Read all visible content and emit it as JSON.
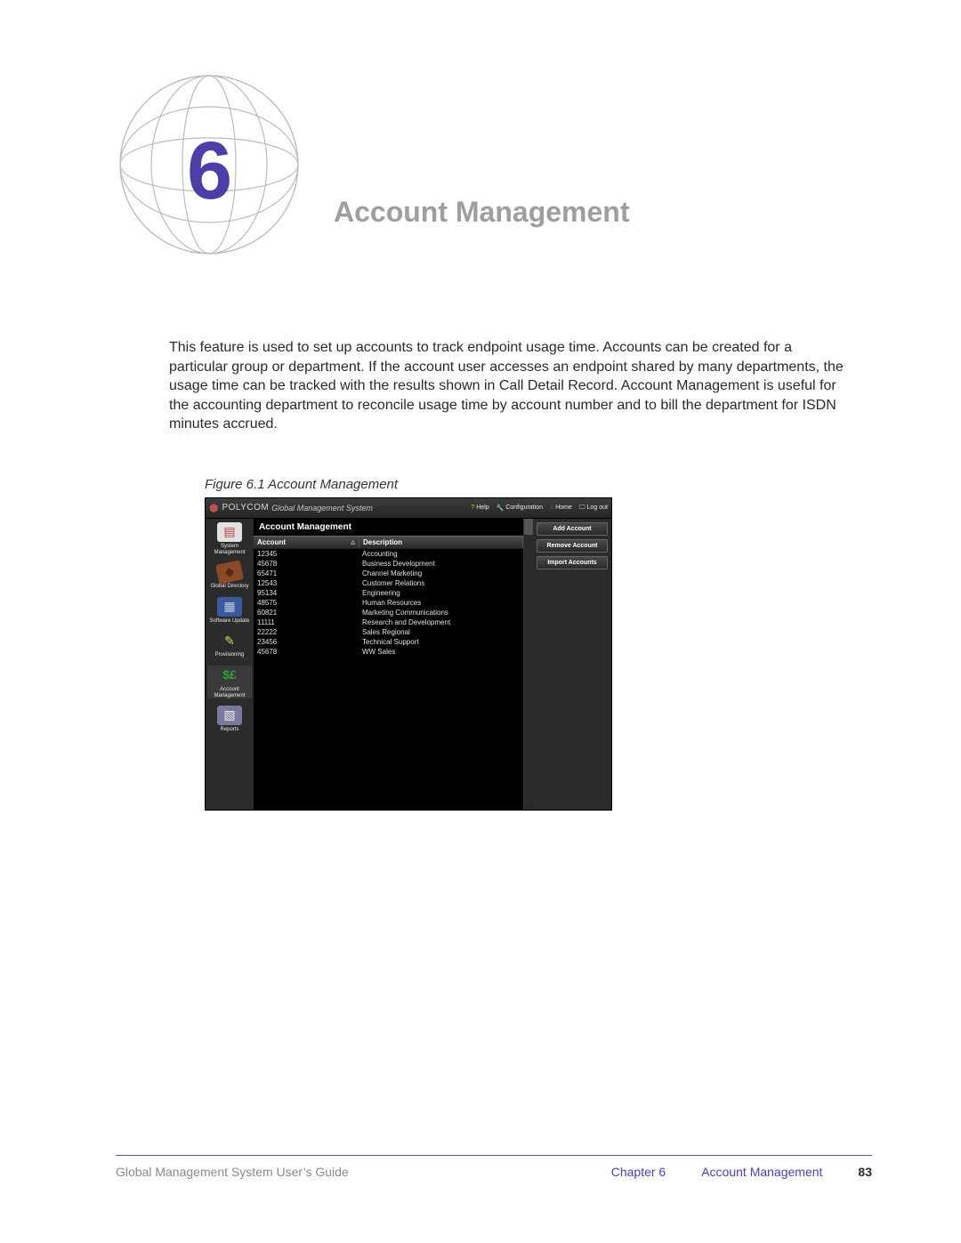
{
  "chapter": {
    "number": "6",
    "title": "Account Management"
  },
  "body_paragraph": "This feature is used to set up accounts to track endpoint usage time. Accounts can be created for a particular group or department. If the account user accesses an endpoint shared by many departments, the usage time can be tracked with the results shown in Call Detail Record. Account Management is useful for the accounting department to reconcile usage time by account number and to bill the department for ISDN minutes accrued.",
  "figure_caption": "Figure 6.1 Account Management",
  "app": {
    "brand": "POLYCOM",
    "system_name": "Global Management System",
    "toolbar": {
      "help": "Help",
      "configuration": "Configuration",
      "home": "Home",
      "logout": "Log out"
    },
    "sidebar": [
      {
        "label": "System Management",
        "icon": "sys"
      },
      {
        "label": "Global Directory",
        "icon": "dir"
      },
      {
        "label": "Software Update",
        "icon": "upd"
      },
      {
        "label": "Provisioning",
        "icon": "prov"
      },
      {
        "label": "Account Management",
        "icon": "acct"
      },
      {
        "label": "Reports",
        "icon": "rep"
      }
    ],
    "panel_title": "Account Management",
    "columns": {
      "account": "Account",
      "description": "Description"
    },
    "rows": [
      {
        "account": "12345",
        "description": "Accounting"
      },
      {
        "account": "45678",
        "description": "Business Development"
      },
      {
        "account": "65471",
        "description": "Channel Marketing"
      },
      {
        "account": "12543",
        "description": "Customer Relations"
      },
      {
        "account": "95134",
        "description": "Engineering"
      },
      {
        "account": "48575",
        "description": "Human Resources"
      },
      {
        "account": "60821",
        "description": "Marketing Communications"
      },
      {
        "account": "11111",
        "description": "Research and Development"
      },
      {
        "account": "22222",
        "description": "Sales Regional"
      },
      {
        "account": "23456",
        "description": "Technical Support"
      },
      {
        "account": "45678",
        "description": "WW Sales"
      }
    ],
    "actions": {
      "add": "Add Account",
      "remove": "Remove Account",
      "import": "Import Accounts"
    }
  },
  "footer": {
    "guide": "Global Management System User’s Guide",
    "chapter_label": "Chapter 6",
    "section_label": "Account Management",
    "page_number": "83"
  }
}
